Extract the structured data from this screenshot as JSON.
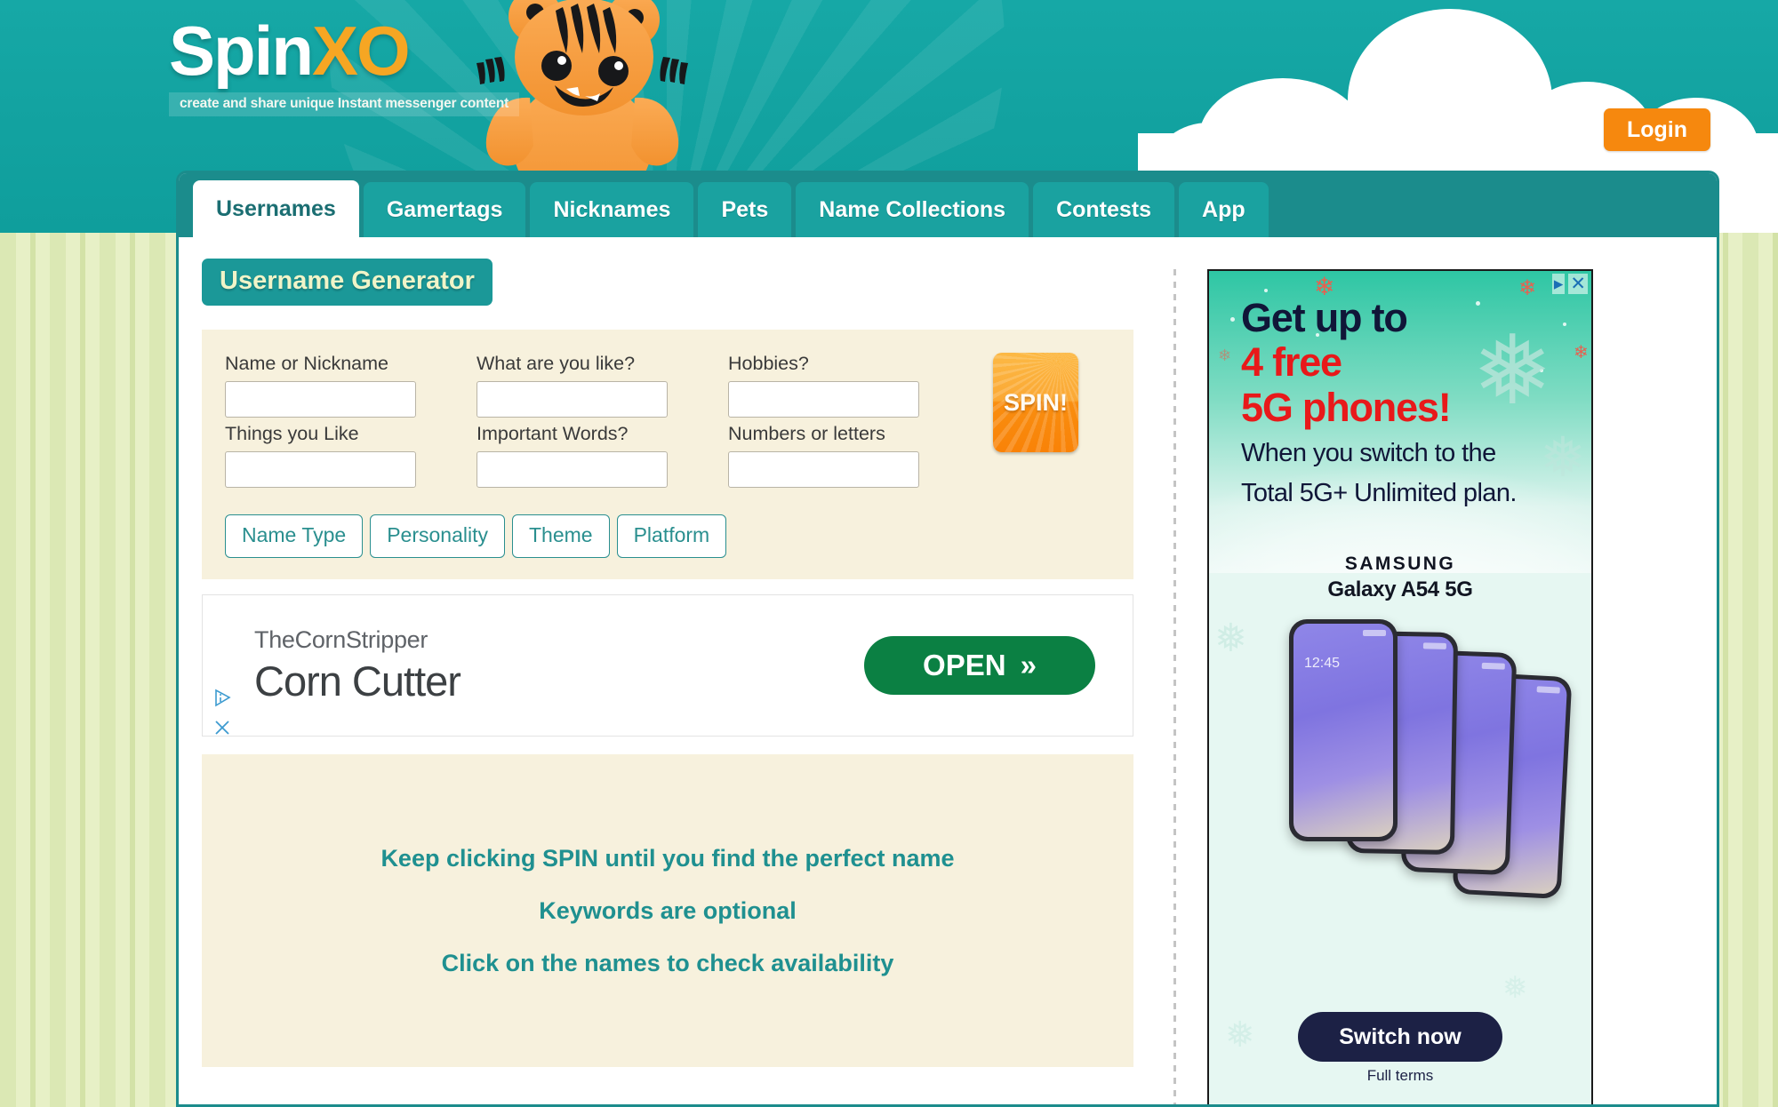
{
  "header": {
    "logo_primary": "Spin",
    "logo_accent": "XO",
    "tagline": "create and share unique Instant messenger content",
    "login_label": "Login",
    "background_color": "#16a8a6",
    "accent_color": "#f6a623"
  },
  "tabs": [
    {
      "label": "Usernames",
      "active": true
    },
    {
      "label": "Gamertags",
      "active": false
    },
    {
      "label": "Nicknames",
      "active": false
    },
    {
      "label": "Pets",
      "active": false
    },
    {
      "label": "Name Collections",
      "active": false
    },
    {
      "label": "Contests",
      "active": false
    },
    {
      "label": "App",
      "active": false
    }
  ],
  "generator": {
    "section_title": "Username Generator",
    "fields": [
      {
        "label": "Name or Nickname",
        "value": "",
        "placeholder": ""
      },
      {
        "label": "What are you like?",
        "value": "",
        "placeholder": ""
      },
      {
        "label": "Hobbies?",
        "value": "",
        "placeholder": ""
      },
      {
        "label": "Things you Like",
        "value": "",
        "placeholder": ""
      },
      {
        "label": "Important Words?",
        "value": "",
        "placeholder": ""
      },
      {
        "label": "Numbers or letters",
        "value": "",
        "placeholder": ""
      }
    ],
    "spin_label": "SPIN!",
    "options": [
      {
        "label": "Name Type"
      },
      {
        "label": "Personality"
      },
      {
        "label": "Theme"
      },
      {
        "label": "Platform"
      }
    ]
  },
  "inline_ad": {
    "brand": "TheCornStripper",
    "title": "Corn Cutter",
    "cta_label": "OPEN",
    "cta_chevron": "»",
    "adchoices_icon": "adchoices-icon",
    "close_icon": "close-icon"
  },
  "hints": {
    "lines": [
      "Keep clicking SPIN until you find the perfect name",
      "Keywords are optional",
      "Click on the names to check availability"
    ],
    "color": "#1f9090"
  },
  "sidebar_ad": {
    "headline_1": "Get up to",
    "headline_2": "4 free",
    "headline_3": "5G phones!",
    "subline_1": "When you switch to the",
    "subline_2": "Total 5G+ Unlimited plan.",
    "brand": "SAMSUNG",
    "model": "Galaxy A54 5G",
    "phone_clock": "12:45",
    "cta_label": "Switch now",
    "terms_label": "Full terms",
    "headline_accent_color": "#e8191a",
    "headline_color": "#101638",
    "cta_color": "#1c2145",
    "adchoices_icon": "adchoices-icon",
    "close_icon": "close-icon"
  }
}
